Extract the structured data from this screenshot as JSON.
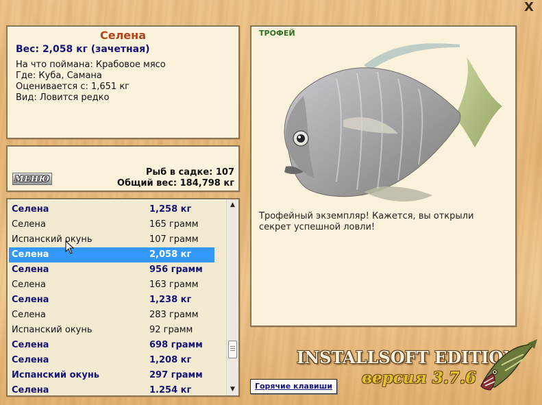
{
  "window": {
    "close_symbol": "X"
  },
  "info": {
    "title": "Селена",
    "weight": "Вес: 2,058 кг (зачетная)",
    "bait": "На что поймана: Крабовое мясо",
    "location": "Где: Куба, Самана",
    "rated_from": "Оценивается с: 1,651 кг",
    "kind": "Вид: Ловится редко"
  },
  "stats": {
    "menu_label": "МЕНЮ",
    "fish_count": "Рыб в садке: 107",
    "total_weight": "Общий вес: 184,798 кг"
  },
  "catch_list": {
    "rows": [
      {
        "name": "Селена",
        "weight": "1,258 кг",
        "style": "bold"
      },
      {
        "name": "Селена",
        "weight": "165 грамм",
        "style": "normal"
      },
      {
        "name": "Испанский окунь",
        "weight": "107 грамм",
        "style": "normal"
      },
      {
        "name": "Селена",
        "weight": "2,058 кг",
        "style": "selected"
      },
      {
        "name": "Селена",
        "weight": "956 грамм",
        "style": "bold"
      },
      {
        "name": "Селена",
        "weight": "163 грамм",
        "style": "normal"
      },
      {
        "name": "Селена",
        "weight": "1,238 кг",
        "style": "bold"
      },
      {
        "name": "Селена",
        "weight": "283 грамм",
        "style": "normal"
      },
      {
        "name": "Испанский окунь",
        "weight": "92 грамм",
        "style": "normal"
      },
      {
        "name": "Селена",
        "weight": "698 грамм",
        "style": "bold"
      },
      {
        "name": "Селена",
        "weight": "1,208 кг",
        "style": "bold"
      },
      {
        "name": "Испанский окунь",
        "weight": "297 грамм",
        "style": "bold"
      },
      {
        "name": "Селена",
        "weight": "1.254 кг",
        "style": "bold"
      }
    ],
    "scroll_up_icon": "▲",
    "scroll_down_icon": "▼"
  },
  "trophy": {
    "label": "ТРОФЕЙ",
    "text": "Трофейный экземпляр! Кажется, вы открыли секрет успешной ловли!"
  },
  "footer": {
    "hotkeys_label": "Горячие клавиши",
    "brand": "INSTALLSOFT EDITION",
    "version": "версия 3.7.6"
  },
  "colors": {
    "title": "#b5441a",
    "highlight_text": "#14147a",
    "selection": "#3399ff",
    "trophy_label": "#2e6e1f"
  }
}
